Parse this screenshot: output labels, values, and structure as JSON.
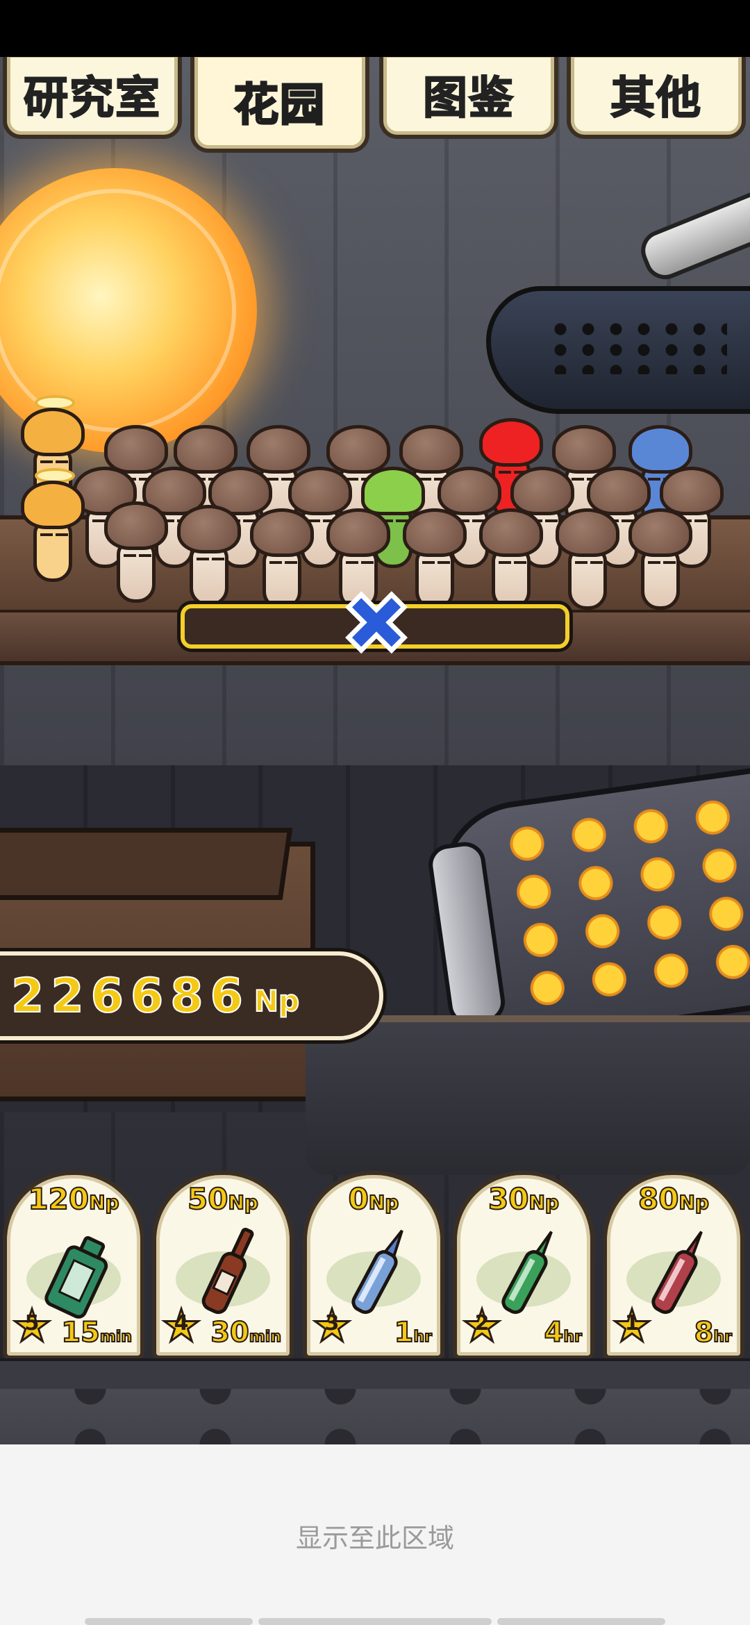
{
  "tabs": [
    {
      "label": "研究室",
      "active": false
    },
    {
      "label": "花园",
      "active": true
    },
    {
      "label": "图鉴",
      "active": false
    },
    {
      "label": "其他",
      "active": false
    }
  ],
  "counter": {
    "value": "226686",
    "unit": "Np"
  },
  "growth_progress": 0,
  "bottles": [
    {
      "price": "120",
      "unit": "Np",
      "star": "5",
      "time": "15",
      "time_unit": "min",
      "color": "#2e8a62"
    },
    {
      "price": "50",
      "unit": "Np",
      "star": "4",
      "time": "30",
      "time_unit": "min",
      "color": "#8a3a22"
    },
    {
      "price": "0",
      "unit": "Np",
      "star": "3",
      "time": "1",
      "time_unit": "hr",
      "color": "#7aa0d8"
    },
    {
      "price": "30",
      "unit": "Np",
      "star": "2",
      "time": "4",
      "time_unit": "hr",
      "color": "#3aa15a"
    },
    {
      "price": "80",
      "unit": "Np",
      "star": "1",
      "time": "8",
      "time_unit": "hr",
      "color": "#b0404a"
    }
  ],
  "bottom_label": "显示至此区域",
  "colors": {
    "accent": "#f4c915",
    "close": "#2a5bd8"
  }
}
